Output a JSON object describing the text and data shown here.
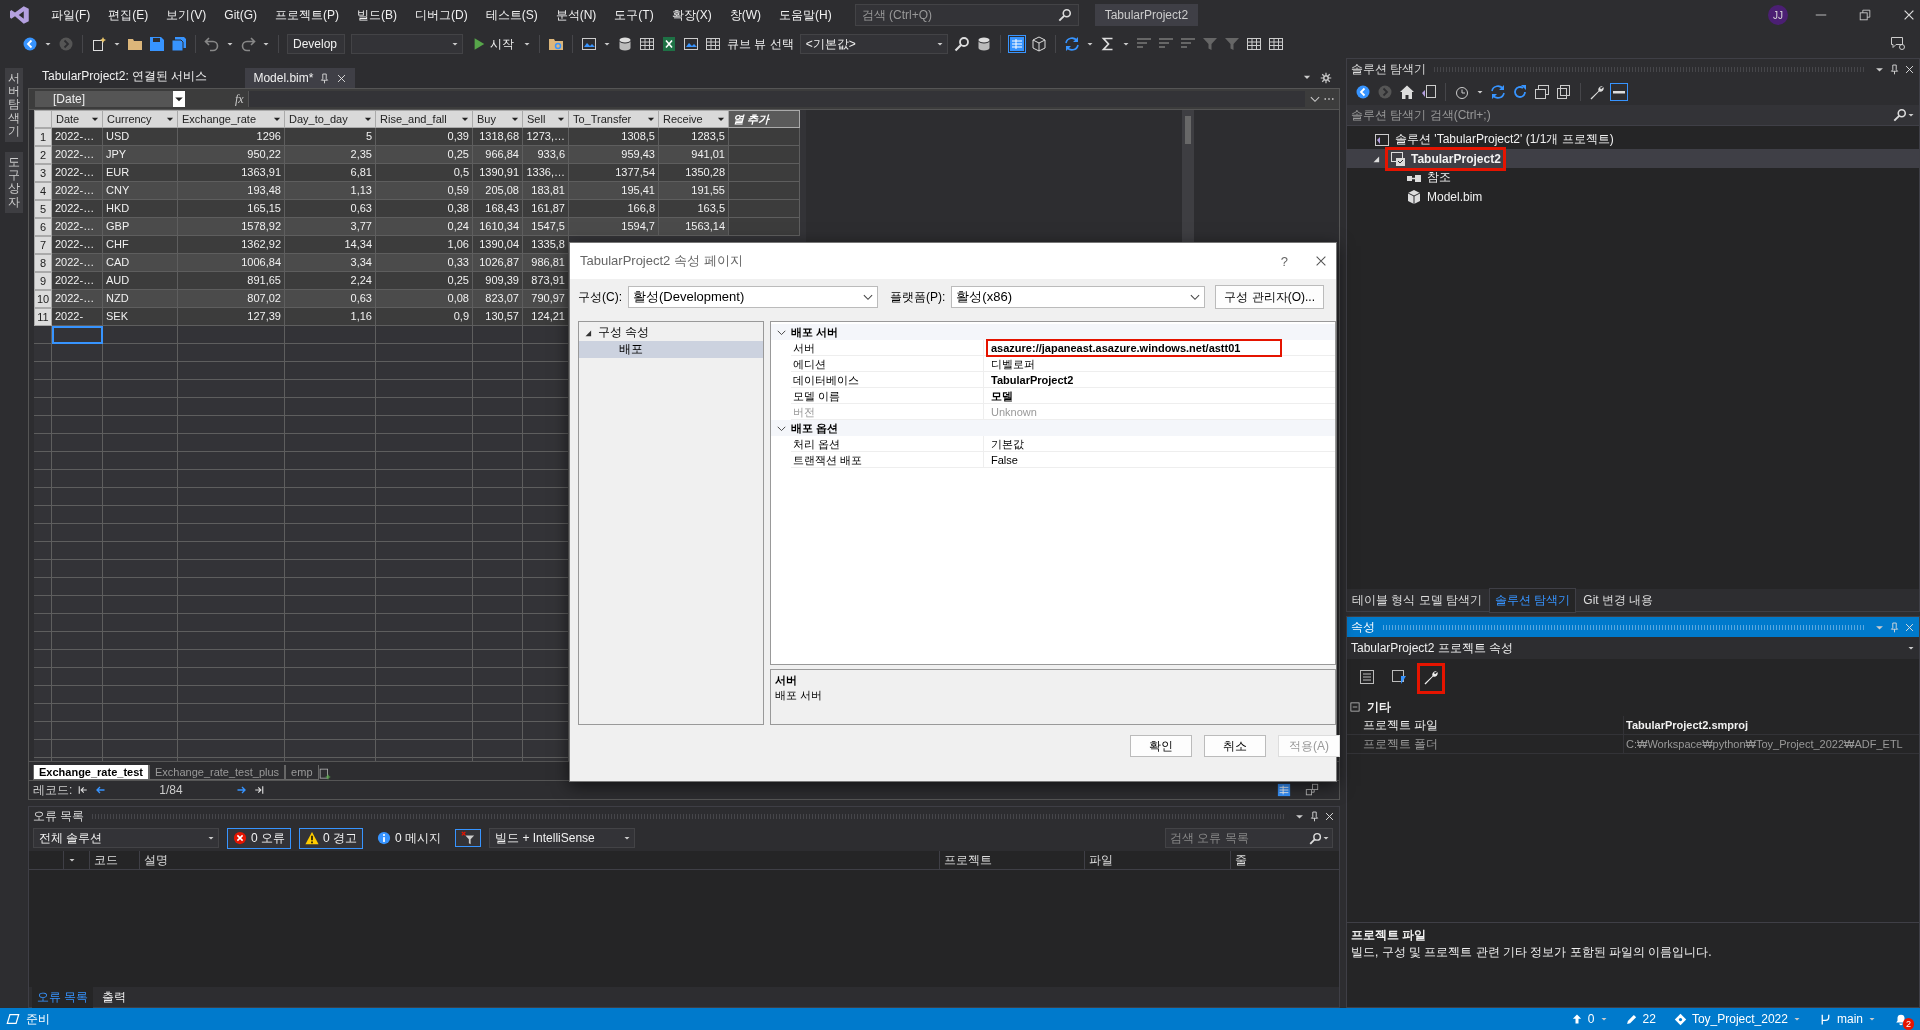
{
  "title_bar": {
    "menu": [
      "파일(F)",
      "편집(E)",
      "보기(V)",
      "Git(G)",
      "프로젝트(P)",
      "빌드(B)",
      "디버그(D)",
      "테스트(S)",
      "분석(N)",
      "도구(T)",
      "확장(X)",
      "창(W)",
      "도움말(H)"
    ],
    "search": {
      "placeholder": "검색 (Ctrl+Q)"
    },
    "title": "TabularProject2",
    "avatar": "JJ"
  },
  "toolbar": {
    "configuration": "Develop",
    "start": "시작",
    "cube_view_label": "큐브 뷰 선택",
    "perspective": "<기본값>"
  },
  "side_tabs": [
    "서버 탐색기",
    "도구 상자"
  ],
  "document_tabs": [
    {
      "label": "TabularProject2: 연결된 서비스",
      "selected": false
    },
    {
      "label": "Model.bim*",
      "selected": true
    }
  ],
  "formula_bar": {
    "column": "[Date]",
    "fx_label": "fx"
  },
  "grid": {
    "columns": [
      "Date",
      "Currency",
      "Exchange_rate",
      "Day_to_day",
      "Rise_and_fall",
      "Buy",
      "Sell",
      "To_Transfer",
      "Receive"
    ],
    "add_column": "열 추가",
    "rows": [
      {
        "number": "1",
        "cells": [
          "2022-…",
          "USD",
          "1296",
          "5",
          "0,39",
          "1318,68",
          "1273,…",
          "1308,5",
          "1283,5"
        ]
      },
      {
        "number": "2",
        "cells": [
          "2022-…",
          "JPY",
          "950,22",
          "2,35",
          "0,25",
          "966,84",
          "933,6",
          "959,43",
          "941,01"
        ]
      },
      {
        "number": "3",
        "cells": [
          "2022-…",
          "EUR",
          "1363,91",
          "6,81",
          "0,5",
          "1390,91",
          "1336,…",
          "1377,54",
          "1350,28"
        ]
      },
      {
        "number": "4",
        "cells": [
          "2022-…",
          "CNY",
          "193,48",
          "1,13",
          "0,59",
          "205,08",
          "183,81",
          "195,41",
          "191,55"
        ]
      },
      {
        "number": "5",
        "cells": [
          "2022-…",
          "HKD",
          "165,15",
          "0,63",
          "0,38",
          "168,43",
          "161,87",
          "166,8",
          "163,5"
        ]
      },
      {
        "number": "6",
        "cells": [
          "2022-…",
          "GBP",
          "1578,92",
          "3,77",
          "0,24",
          "1610,34",
          "1547,5",
          "1594,7",
          "1563,14"
        ]
      },
      {
        "number": "7",
        "cells": [
          "2022-…",
          "CHF",
          "1362,92",
          "14,34",
          "1,06",
          "1390,04",
          "1335,8",
          null,
          null
        ]
      },
      {
        "number": "8",
        "cells": [
          "2022-…",
          "CAD",
          "1006,84",
          "3,34",
          "0,33",
          "1026,87",
          "986,81",
          null,
          null
        ]
      },
      {
        "number": "9",
        "cells": [
          "2022-…",
          "AUD",
          "891,65",
          "2,24",
          "0,25",
          "909,39",
          "873,91",
          null,
          null
        ]
      },
      {
        "number": "10",
        "cells": [
          "2022-…",
          "NZD",
          "807,02",
          "0,63",
          "0,08",
          "823,07",
          "790,97",
          null,
          null
        ]
      },
      {
        "number": "11",
        "cells": [
          "2022-",
          "SEK",
          "127,39",
          "1,16",
          "0,9",
          "130,57",
          "124,21",
          null,
          null
        ]
      }
    ],
    "new_row": {
      "selected": true
    }
  },
  "sheet_tabs": [
    {
      "label": "Exchange_rate_test",
      "selected": true
    },
    {
      "label": "Exchange_rate_test_plus",
      "selected": false
    },
    {
      "label": "emp",
      "selected": false
    }
  ],
  "record_nav": {
    "label": "레코드:",
    "position": "1/84"
  },
  "error_list": {
    "title": "오류 목록",
    "scope": "전체 솔루션",
    "filters": [
      {
        "kind": "error",
        "label": "0 오류",
        "selected": true
      },
      {
        "kind": "warning",
        "label": "0 경고",
        "selected": true
      },
      {
        "kind": "message",
        "label": "0 메시지",
        "selected": false
      }
    ],
    "source": "빌드 + IntelliSense",
    "search": {
      "placeholder": "검색 오류 목록"
    },
    "columns": [
      "코드",
      "설명",
      "프로젝트",
      "파일",
      "줄"
    ],
    "tabs": [
      {
        "label": "오류 목록",
        "selected": true
      },
      {
        "label": "출력",
        "selected": false
      }
    ]
  },
  "solution_explorer": {
    "title": "솔루션 탐색기",
    "search": {
      "placeholder": "솔루션 탐색기 검색(Ctrl+;)"
    },
    "tree": [
      {
        "label": "솔루션 'TabularProject2' (1/1개 프로젝트)",
        "kind": "solution",
        "selected": false,
        "annotated": false,
        "children": [
          {
            "label": "TabularProject2",
            "kind": "project",
            "expanded": true,
            "selected": true,
            "annotated": true,
            "children": [
              {
                "label": "참조",
                "kind": "references",
                "selected": false,
                "annotated": false
              },
              {
                "label": "Model.bim",
                "kind": "model",
                "selected": false,
                "annotated": false
              }
            ]
          }
        ]
      }
    ],
    "tabs": [
      {
        "label": "테이블 형식 모델 탐색기",
        "selected": false
      },
      {
        "label": "솔루션 탐색기",
        "selected": true
      },
      {
        "label": "Git 변경 내용",
        "selected": false
      }
    ]
  },
  "properties": {
    "title": "속성",
    "subject": "TabularProject2 프로젝트 속성",
    "tools": [
      {
        "kind": "categorized",
        "annotated": false
      },
      {
        "kind": "events",
        "annotated": false
      },
      {
        "kind": "property_pages",
        "annotated": true
      }
    ],
    "category": {
      "label": "기타",
      "expanded": true
    },
    "rows": [
      {
        "name": "프로젝트 파일",
        "value": "TabularProject2.smproj",
        "disabled": false
      },
      {
        "name": "프로젝트 폴더",
        "value": "C:₩Workspace₩python₩Toy_Project_2022₩ADF_ETL",
        "disabled": true
      }
    ],
    "description": {
      "title": "프로젝트 파일",
      "text": "빌드, 구성 및 프로젝트 관련 기타 정보가 포함된 파일의 이름입니다."
    }
  },
  "dialog": {
    "title": "TabularProject2 속성 페이지",
    "help": "?",
    "configuration_label": "구성(C):",
    "configuration": "활성(Development)",
    "platform_label": "플랫폼(P):",
    "platform": "활성(x86)",
    "manager_button": "구성 관리자(O)...",
    "tree": [
      {
        "label": "구성 속성",
        "expanded": true,
        "selected": false,
        "children": [
          {
            "label": "배포",
            "selected": true
          }
        ]
      }
    ],
    "categories": [
      {
        "label": "배포 서버",
        "expanded": true,
        "rows": [
          {
            "name": "서버",
            "value": "asazure://japaneast.asazure.windows.net/astt01",
            "modified": true,
            "disabled": false,
            "annotated": true
          },
          {
            "name": "에디션",
            "value": "디벨로퍼",
            "modified": false,
            "disabled": false,
            "annotated": false
          },
          {
            "name": "데이터베이스",
            "value": "TabularProject2",
            "modified": true,
            "disabled": false,
            "annotated": false
          },
          {
            "name": "모델 이름",
            "value": "모델",
            "modified": true,
            "disabled": false,
            "annotated": false
          },
          {
            "name": "버전",
            "value": "Unknown",
            "modified": false,
            "disabled": true,
            "annotated": false
          }
        ]
      },
      {
        "label": "배포 옵션",
        "expanded": true,
        "rows": [
          {
            "name": "처리 옵션",
            "value": "기본값",
            "modified": false,
            "disabled": false,
            "annotated": false
          },
          {
            "name": "트랜잭션 배포",
            "value": "False",
            "modified": false,
            "disabled": false,
            "annotated": false
          }
        ]
      }
    ],
    "description": {
      "title": "서버",
      "text": "배포 서버"
    },
    "buttons": [
      {
        "label": "확인",
        "disabled": false
      },
      {
        "label": "취소",
        "disabled": false
      },
      {
        "label": "적용(A)",
        "disabled": true
      }
    ]
  },
  "status_bar": {
    "status": "준비",
    "push": "0",
    "changes": "22",
    "repository": "Toy_Project_2022",
    "branch": "main",
    "notifications": "2"
  }
}
